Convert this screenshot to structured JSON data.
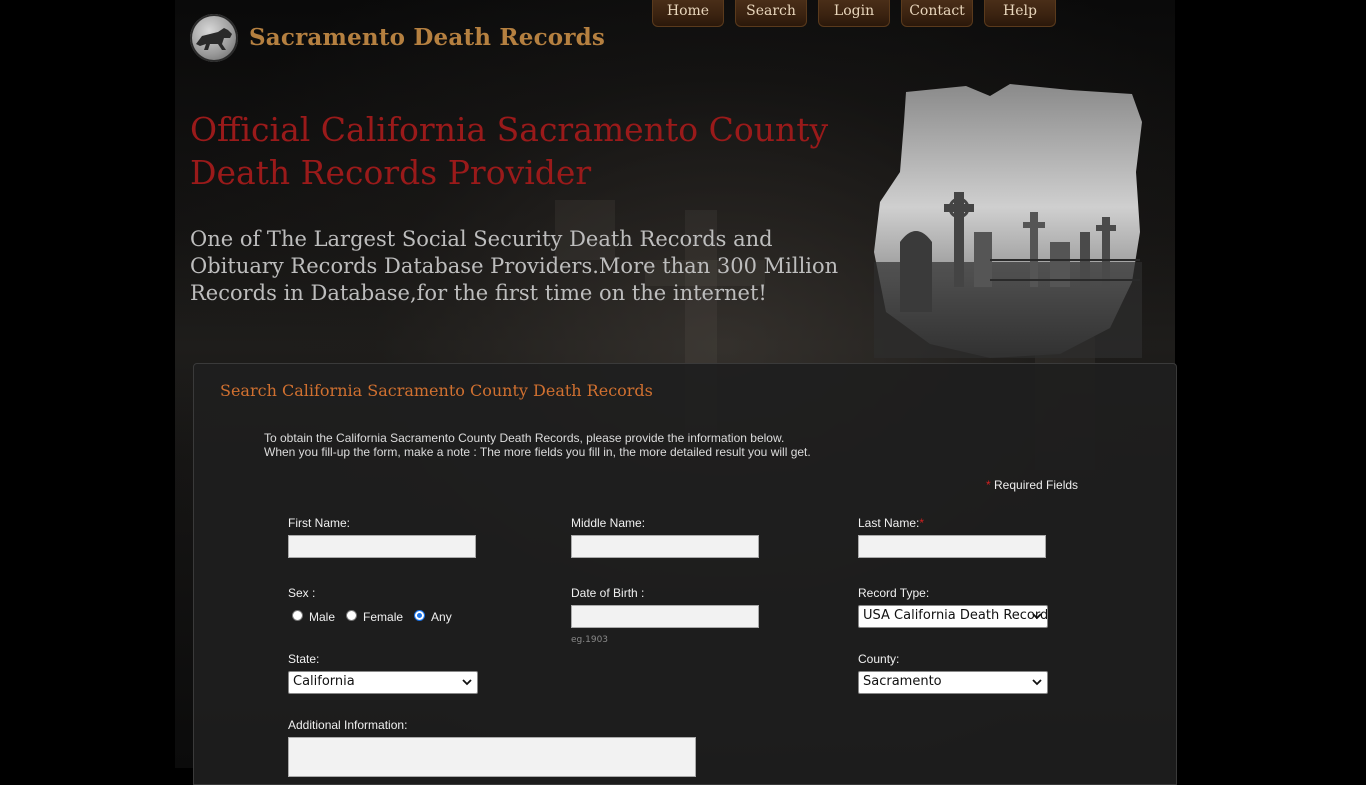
{
  "site": {
    "title": "Sacramento Death Records",
    "logo_icon": "wolf-logo-icon"
  },
  "nav": {
    "items": [
      {
        "label": "Home"
      },
      {
        "label": "Search"
      },
      {
        "label": "Login"
      },
      {
        "label": "Contact"
      },
      {
        "label": "Help"
      }
    ]
  },
  "hero": {
    "headline": "Official California Sacramento County Death Records Provider",
    "subhead": "One of The Largest Social Security Death Records and Obituary Records Database Providers.More than 300 Million Records in Database,for the first time on the internet!",
    "image_icon": "cemetery-image"
  },
  "search": {
    "title": "Search California Sacramento County Death Records",
    "intro_line1": "To obtain the California Sacramento County Death Records, please provide the information below.",
    "intro_line2": "When you fill-up the form, make a note : The more fields you fill in, the more detailed result you will get.",
    "required_star": "*",
    "required_label": "Required Fields",
    "fields": {
      "first_name": {
        "label": "First Name:",
        "value": ""
      },
      "middle_name": {
        "label": "Middle Name:",
        "value": ""
      },
      "last_name": {
        "label": "Last Name:",
        "required": "*",
        "value": ""
      },
      "sex": {
        "label": "Sex :",
        "options": [
          "Male",
          "Female",
          "Any"
        ],
        "selected": "Any"
      },
      "dob": {
        "label": "Date of Birth :",
        "value": "",
        "hint": "eg.1903"
      },
      "record_type": {
        "label": "Record Type:",
        "value": "USA California Death Records"
      },
      "state": {
        "label": "State:",
        "value": "California"
      },
      "county": {
        "label": "County:",
        "value": "Sacramento"
      },
      "additional": {
        "label": "Additional Information:",
        "value": ""
      }
    }
  },
  "colors": {
    "accent_brown": "#b58040",
    "headline_red": "#9a1a1a",
    "panel_title_orange": "#d07030",
    "required_red": "#d02020"
  }
}
